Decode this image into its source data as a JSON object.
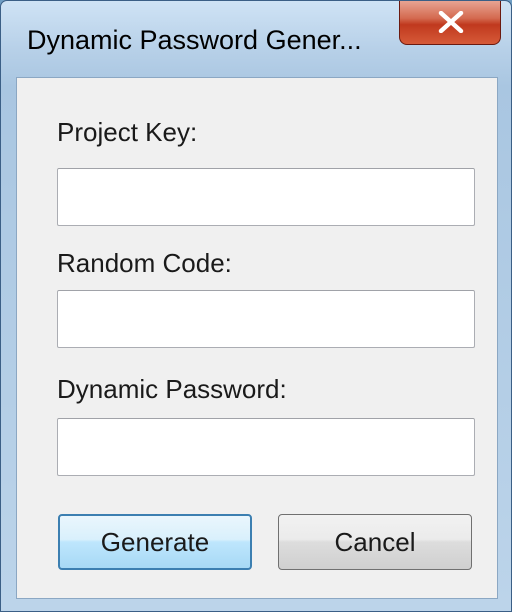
{
  "window": {
    "title": "Dynamic Password Gener...",
    "close_icon": "close-x-icon"
  },
  "form": {
    "project_key": {
      "label": "Project Key:",
      "value": "",
      "placeholder": ""
    },
    "random_code": {
      "label": "Random Code:",
      "value": "",
      "placeholder": ""
    },
    "dynamic_password": {
      "label": "Dynamic Password:",
      "value": "",
      "placeholder": ""
    }
  },
  "buttons": {
    "generate_label": "Generate",
    "cancel_label": "Cancel"
  },
  "colors": {
    "close_button_red": "#c0391e",
    "default_button_border": "#3c7fb1",
    "dialog_background": "#f0f0f0"
  }
}
